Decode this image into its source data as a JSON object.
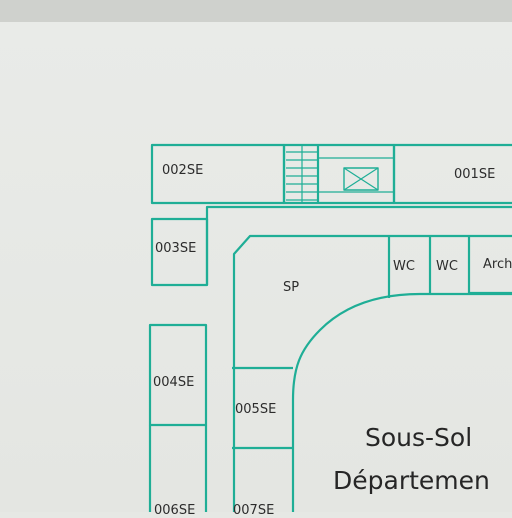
{
  "rooms": {
    "r002": "002SE",
    "r001": "001SE",
    "r003": "003SE",
    "wc1": "WC",
    "wc2": "WC",
    "arch": "Arch",
    "sp": "SP",
    "r004": "004SE",
    "r005": "005SE",
    "r006": "006SE",
    "r007": "007SE"
  },
  "title": {
    "line1": "Sous-Sol",
    "line2": "Départemen"
  },
  "colors": {
    "wall": "#1fae96",
    "paper": "#e7e9e6",
    "text": "#2c2c2c"
  }
}
